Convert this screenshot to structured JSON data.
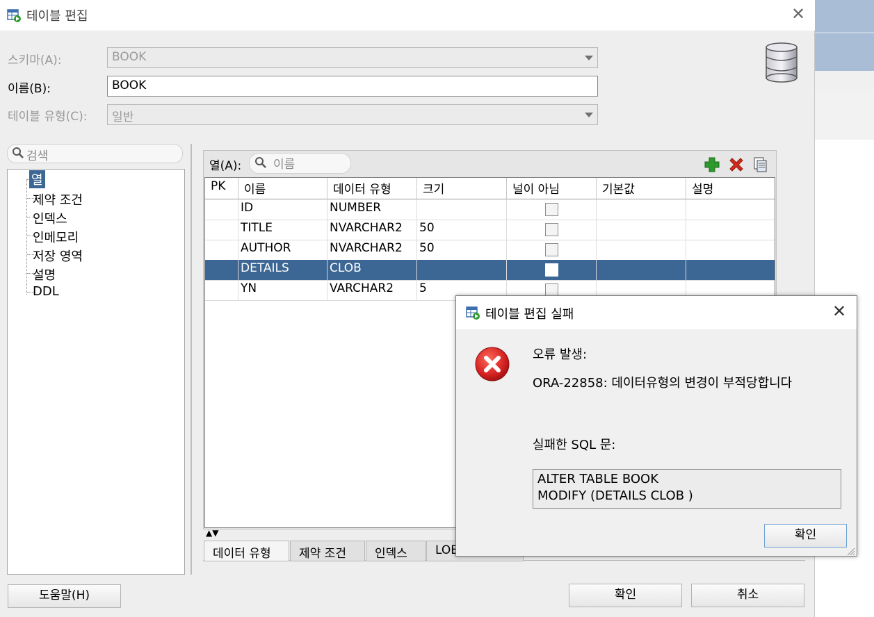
{
  "main_dialog": {
    "title": "테이블 편집",
    "close_glyph": "✕",
    "schema": {
      "label": "스키마(A):",
      "value": "BOOK"
    },
    "name": {
      "label": "이름(B):",
      "value": "BOOK"
    },
    "table_type": {
      "label": "테이블 유형(C):",
      "value": "일반"
    },
    "nav_search_placeholder": "검색",
    "nav_items": [
      "열",
      "제약 조건",
      "인덱스",
      "인메모리",
      "저장 영역",
      "설명",
      "DDL"
    ],
    "nav_selected": "열",
    "columns_label": "열(A):",
    "columns_search_placeholder": "이름",
    "grid_headers": [
      "PK",
      "이름",
      "데이터 유형",
      "크기",
      "널이 아님",
      "기본값",
      "설명"
    ],
    "grid_rows": [
      {
        "pk": "",
        "name": "ID",
        "type": "NUMBER",
        "size": "",
        "not_null": false,
        "default": "",
        "comment": ""
      },
      {
        "pk": "",
        "name": "TITLE",
        "type": "NVARCHAR2",
        "size": "50",
        "not_null": false,
        "default": "",
        "comment": ""
      },
      {
        "pk": "",
        "name": "AUTHOR",
        "type": "NVARCHAR2",
        "size": "50",
        "not_null": false,
        "default": "",
        "comment": ""
      },
      {
        "pk": "",
        "name": "DETAILS",
        "type": "CLOB",
        "size": "",
        "not_null": false,
        "default": "",
        "comment": "",
        "selected": true
      },
      {
        "pk": "",
        "name": "YN",
        "type": "VARCHAR2",
        "size": "5",
        "not_null": false,
        "default": "",
        "comment": ""
      }
    ],
    "bottom_tabs": [
      "데이터 유형",
      "제약 조건",
      "인덱스",
      "LOB"
    ],
    "help_button": "도움말(H)",
    "ok_button": "확인",
    "cancel_button": "취소",
    "icons": [
      "table-edit-icon",
      "database-icon",
      "search-icon",
      "add-icon",
      "delete-icon",
      "copy-icon"
    ]
  },
  "error_dialog": {
    "title": "테이블 편집 실패",
    "close_glyph": "✕",
    "error_heading": "오류 발생:",
    "error_message": "ORA-22858: 데이터유형의 변경이 부적당합니다",
    "sql_heading": "실패한 SQL 문:",
    "sql_lines": [
      "ALTER TABLE BOOK",
      "MODIFY (DETAILS CLOB )"
    ],
    "ok_button": "확인"
  },
  "colors": {
    "selection": "#3c6694",
    "add_icon": "#2e9a2e",
    "delete_icon": "#d42a1a",
    "error_icon": "#d21f1f"
  }
}
